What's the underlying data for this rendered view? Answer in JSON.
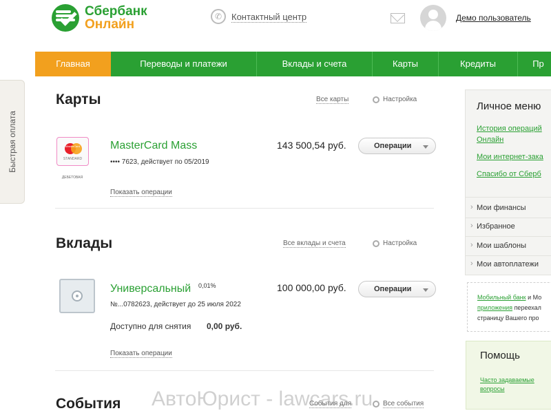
{
  "header": {
    "logo_line1": "Сбербанк",
    "logo_line2": "Онлайн",
    "contact_center": "Контактный центр",
    "user_name": "Демо пользователь"
  },
  "nav": {
    "items": [
      "Главная",
      "Переводы и платежи",
      "Вклады и счета",
      "Карты",
      "Кредиты",
      "Пр"
    ],
    "active": "Главная"
  },
  "quick_pay": "Быстрая оплата",
  "cards": {
    "title": "Карты",
    "all_link": "Все карты",
    "settings": "Настройка",
    "card": {
      "brand_label": "MasterCard",
      "standard_label": "STANDARD",
      "caption": "ДЕБЕТОВАЯ",
      "name": "MasterCard Mass",
      "details": "•••• 7623, действует по 05/2019",
      "amount": "143 500,54 руб.",
      "ops_button": "Операции",
      "show_ops": "Показать операции"
    }
  },
  "deposits": {
    "title": "Вклады",
    "all_link": "Все вклады и счета",
    "settings": "Настройка",
    "deposit": {
      "name": "Универсальный",
      "rate": "0,01%",
      "details": "№...0782623, действует до 25 июля 2022",
      "amount": "100 000,00 руб.",
      "ops_button": "Операции",
      "available_label": "Доступно для снятия",
      "available_value": "0,00 руб.",
      "show_ops": "Показать операции"
    }
  },
  "events": {
    "title": "События",
    "link1": "События для",
    "link2": "Все события"
  },
  "personal_menu": {
    "title": "Личное меню",
    "links": [
      "История операций",
      "Онлайн",
      "Мои интернет-зака",
      "Спасибо от Сберб"
    ],
    "items": [
      "Мои финансы",
      "Избранное",
      "Мои шаблоны",
      "Мои автоплатежи"
    ]
  },
  "mobile": {
    "line1_link": "Мобильный банк",
    "line1_rest": " и Мо",
    "line2_link": "приложения",
    "line2_rest": " переехал",
    "line3": "страницу Вашего про"
  },
  "help": {
    "title": "Помощь",
    "link_line1": "Часто задаваемые",
    "link_line2": "вопросы"
  },
  "watermark": "АвтоЮрист - lawcars.ru",
  "colors": {
    "brand_green": "#2aa033",
    "active_orange": "#f2a01e"
  }
}
